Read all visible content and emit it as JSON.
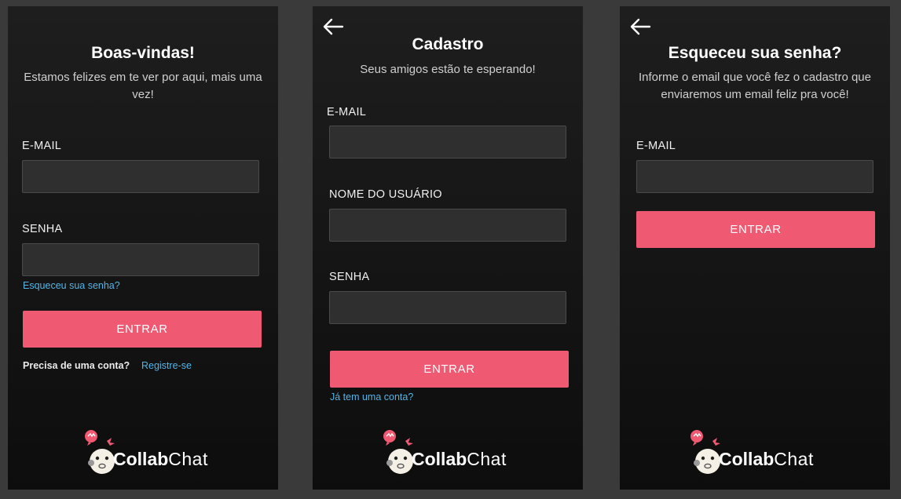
{
  "brand": {
    "name_bold": "Collab",
    "name_light": "Chat"
  },
  "colors": {
    "accent": "#ef5a72",
    "link": "#55b4e6",
    "panel": "#1a1a1a"
  },
  "login": {
    "title": "Boas-vindas!",
    "subtitle": "Estamos felizes em te ver por aqui, mais uma vez!",
    "email_label": "E-MAIL",
    "password_label": "SENHA",
    "forgot_link": "Esqueceu sua senha?",
    "submit_label": "ENTRAR",
    "need_account_text": "Precisa de uma conta?",
    "register_link": "Registre-se"
  },
  "register": {
    "back_icon": "arrow-left-icon",
    "title": "Cadastro",
    "subtitle": "Seus amigos estão te esperando!",
    "email_label": "E-MAIL",
    "username_label": "NOME DO USUÁRIO",
    "password_label": "SENHA",
    "submit_label": "ENTRAR",
    "have_account_link": "Já tem uma conta?"
  },
  "forgot": {
    "back_icon": "arrow-left-icon",
    "title": "Esqueceu sua senha?",
    "subtitle": "Informe o email que você fez o cadastro que enviaremos um email feliz pra você!",
    "email_label": "E-MAIL",
    "submit_label": "ENTRAR"
  }
}
